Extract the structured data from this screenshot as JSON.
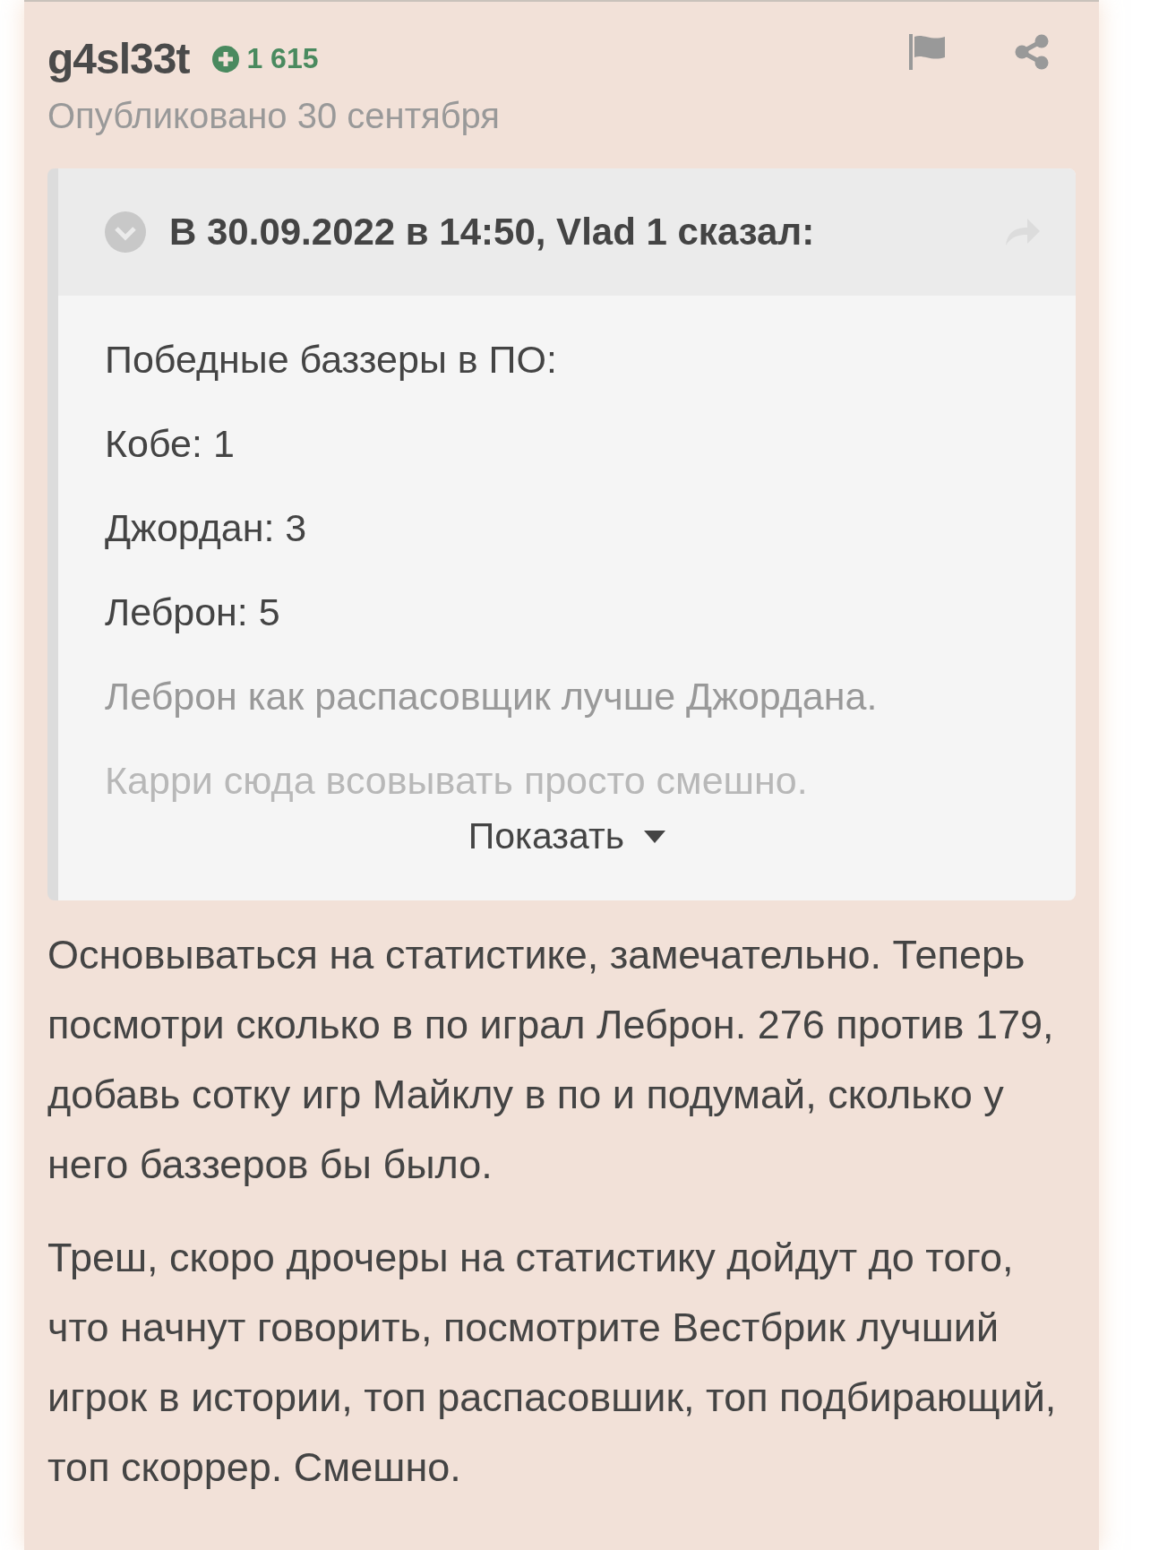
{
  "post": {
    "author": "g4sl33t",
    "reputation": "1 615",
    "published": "Опубликовано 30 сентября",
    "quote": {
      "citation": "В 30.09.2022 в 14:50, Vlad 1 сказал:",
      "expanded": false,
      "lines": [
        "Победные баззеры в ПО:",
        "Кобе: 1",
        "Джордан: 3",
        "Леброн: 5",
        "Леброн как распасовщик лучше Джордана.",
        "Карри сюда всовывать просто смешно."
      ],
      "toggle": "Показать"
    },
    "paragraphs": [
      "Основываться на статистике, замечательно. Теперь посмотри сколько в по играл Леброн. 276 против 179, добавь сотку игр Майклу в по и подумай, сколько у него баззеров бы было.",
      "Треш, скоро дрочеры на статистику дойдут до того, что начнут говорить, посмотрите Вестбрик лучший игрок в истории, топ распасовшик, топ подбирающий, топ скоррер. Смешно."
    ]
  }
}
